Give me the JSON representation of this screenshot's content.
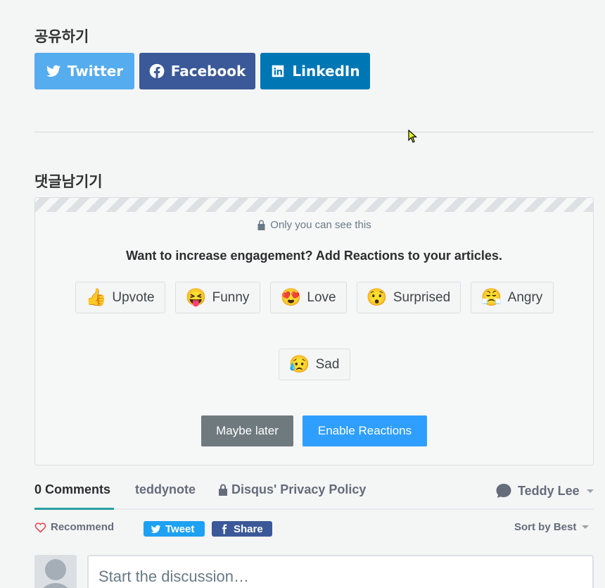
{
  "share": {
    "title": "공유하기",
    "buttons": [
      {
        "label": "Twitter",
        "icon": "twitter-icon",
        "color": "#55acee"
      },
      {
        "label": "Facebook",
        "icon": "facebook-icon",
        "color": "#3b5998"
      },
      {
        "label": "LinkedIn",
        "icon": "linkedin-icon",
        "color": "#0077b5"
      }
    ]
  },
  "comment": {
    "title": "댓글남기기"
  },
  "reactions_prompt": {
    "visibility_note": "Only you can see this",
    "headline": "Want to increase engagement? Add Reactions to your articles.",
    "reactions": [
      {
        "label": "Upvote",
        "emoji": "👍"
      },
      {
        "label": "Funny",
        "emoji": "😝"
      },
      {
        "label": "Love",
        "emoji": "😍"
      },
      {
        "label": "Surprised",
        "emoji": "😯"
      },
      {
        "label": "Angry",
        "emoji": "😤"
      },
      {
        "label": "Sad",
        "emoji": "😥"
      }
    ],
    "maybe_later": "Maybe later",
    "enable": "Enable Reactions"
  },
  "disqus": {
    "tabs": {
      "comments": "0 Comments",
      "forum": "teddynote",
      "privacy": "Disqus' Privacy Policy"
    },
    "user": "Teddy Lee",
    "recommend": "Recommend",
    "tweet": "Tweet",
    "share": "Share",
    "sort": "Sort by Best",
    "input_placeholder": "Start the discussion…"
  },
  "colors": {
    "accent": "#2e9fff",
    "secondary_button": "#6f7a7f"
  }
}
